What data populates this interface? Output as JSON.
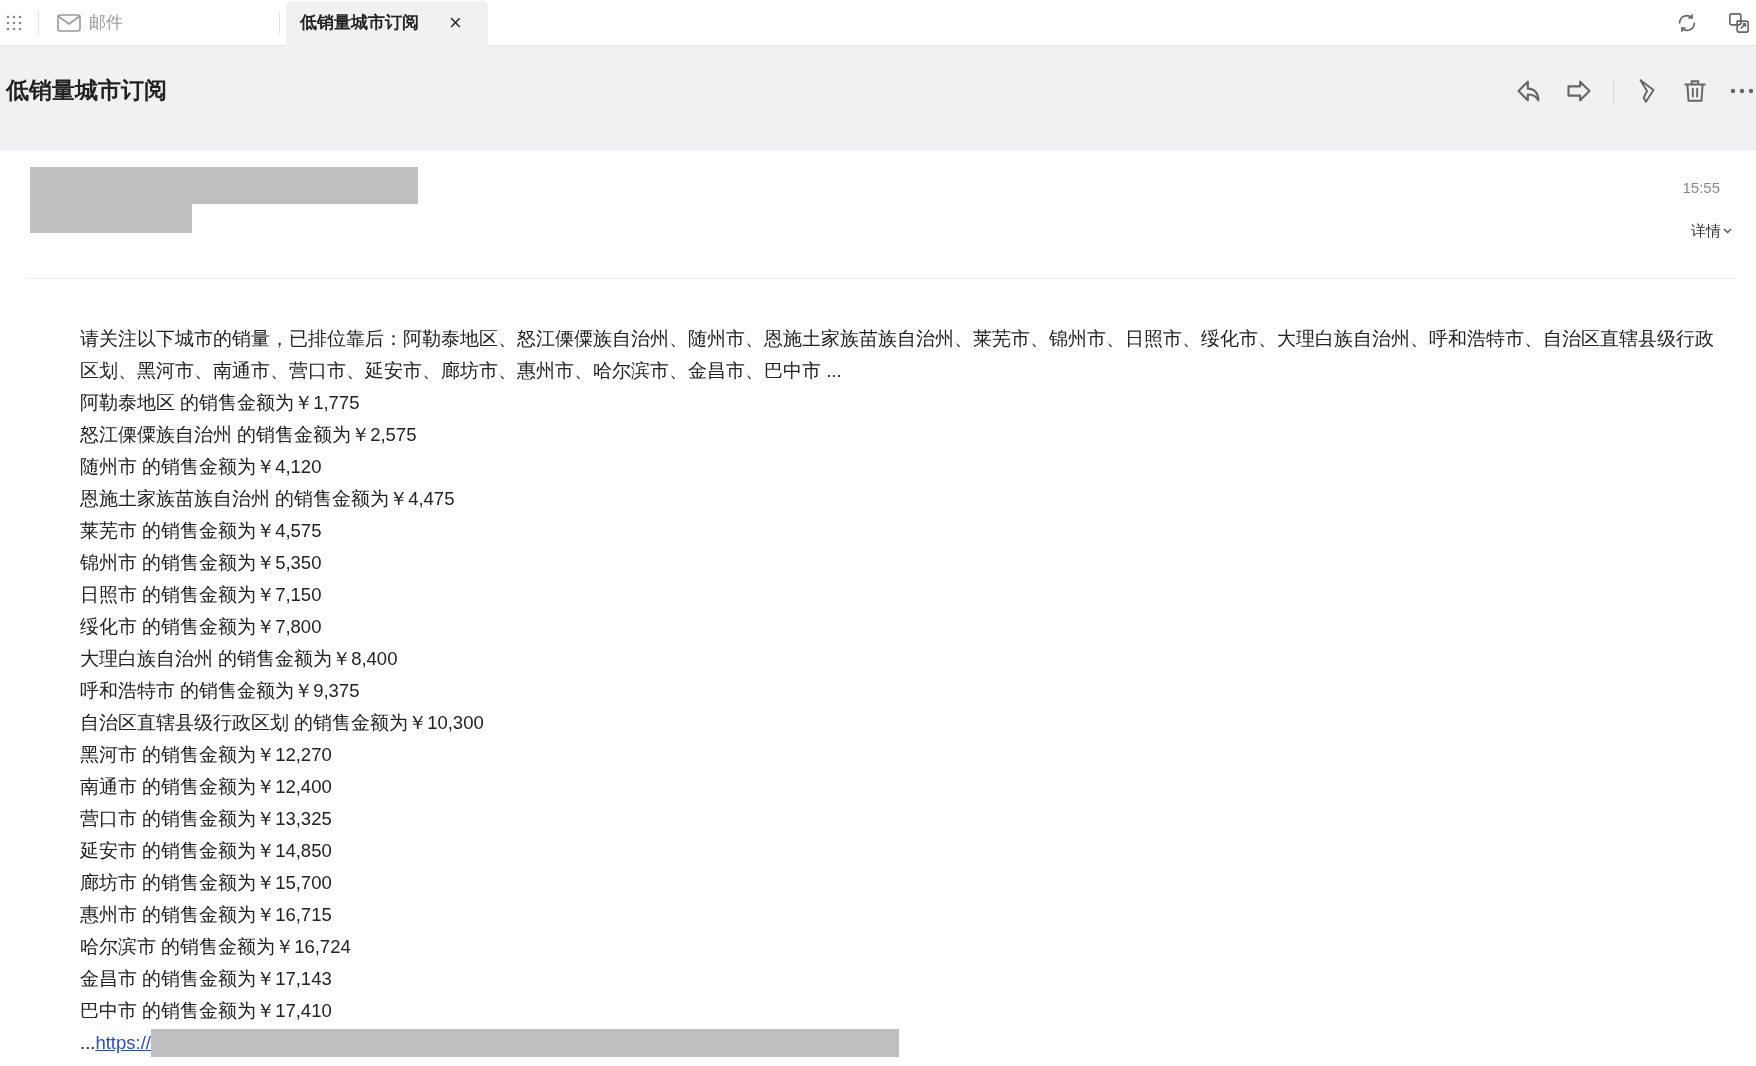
{
  "tabs": [
    {
      "label": "邮件",
      "selected": false,
      "closable": false
    },
    {
      "label": "低销量城市订阅",
      "selected": true,
      "closable": true
    }
  ],
  "close_glyph": "×",
  "subject": "低销量城市订阅",
  "message": {
    "time": "15:55",
    "details_label": "详情",
    "intro": "请关注以下城市的销量，已排位靠后：阿勒泰地区、怒江傈僳族自治州、随州市、恩施土家族苗族自治州、莱芜市、锦州市、日照市、绥化市、大理白族自治州、呼和浩特市、自治区直辖县级行政区划、黑河市、南通市、营口市、延安市、廊坊市、惠州市、哈尔滨市、金昌市、巴中市 ...",
    "lines": [
      "阿勒泰地区 的销售金额为￥1,775",
      "怒江傈僳族自治州 的销售金额为￥2,575",
      "随州市 的销售金额为￥4,120",
      "恩施土家族苗族自治州 的销售金额为￥4,475",
      "莱芜市 的销售金额为￥4,575",
      "锦州市 的销售金额为￥5,350",
      "日照市 的销售金额为￥7,150",
      "绥化市 的销售金额为￥7,800",
      "大理白族自治州 的销售金额为￥8,400",
      "呼和浩特市 的销售金额为￥9,375",
      "自治区直辖县级行政区划 的销售金额为￥10,300",
      "黑河市 的销售金额为￥12,270",
      "南通市 的销售金额为￥12,400",
      "营口市 的销售金额为￥13,325",
      "延安市 的销售金额为￥14,850",
      "廊坊市 的销售金额为￥15,700",
      "惠州市 的销售金额为￥16,715",
      "哈尔滨市 的销售金额为￥16,724",
      "金昌市 的销售金额为￥17,143",
      "巴中市 的销售金额为￥17,410"
    ],
    "link_prefix": "...",
    "link": "https://"
  }
}
